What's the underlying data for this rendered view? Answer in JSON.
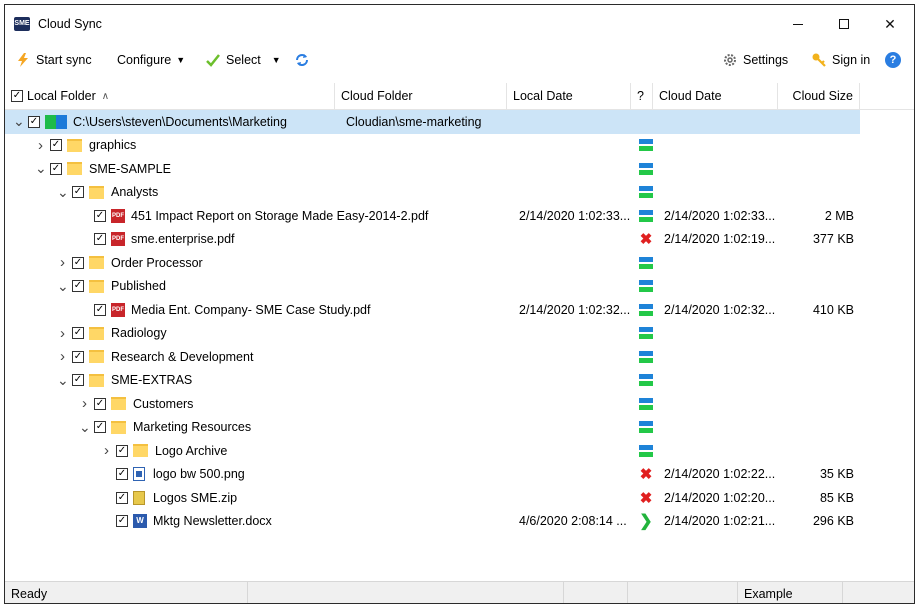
{
  "window": {
    "title": "Cloud Sync",
    "app_icon_text": "SME"
  },
  "toolbar": {
    "start_sync": "Start sync",
    "configure": "Configure",
    "select": "Select",
    "settings": "Settings",
    "sign_in": "Sign in"
  },
  "columns": {
    "local_folder": "Local Folder",
    "cloud_folder": "Cloud Folder",
    "local_date": "Local Date",
    "question": "?",
    "cloud_date": "Cloud Date",
    "cloud_size": "Cloud Size"
  },
  "rows": [
    {
      "name": "C:\\Users\\steven\\Documents\\Marketing",
      "cloud_folder": "Cloudian\\sme-marketing",
      "local_date": "",
      "cloud_date": "",
      "size": "",
      "status": "none",
      "type": "root",
      "expanded": true
    },
    {
      "name": "graphics",
      "cloud_folder": "",
      "local_date": "",
      "cloud_date": "",
      "size": "",
      "status": "synced",
      "type": "folder",
      "expanded": false
    },
    {
      "name": "SME-SAMPLE",
      "cloud_folder": "",
      "local_date": "",
      "cloud_date": "",
      "size": "",
      "status": "synced",
      "type": "folder",
      "expanded": true
    },
    {
      "name": "Analysts",
      "cloud_folder": "",
      "local_date": "",
      "cloud_date": "",
      "size": "",
      "status": "synced",
      "type": "folder",
      "expanded": true
    },
    {
      "name": "451 Impact Report on Storage Made Easy-2014-2.pdf",
      "cloud_folder": "",
      "local_date": "2/14/2020 1:02:33...",
      "cloud_date": "2/14/2020 1:02:33...",
      "size": "2 MB",
      "status": "synced",
      "type": "pdf"
    },
    {
      "name": "sme.enterprise.pdf",
      "cloud_folder": "",
      "local_date": "",
      "cloud_date": "2/14/2020 1:02:19...",
      "size": "377 KB",
      "status": "delete",
      "type": "pdf"
    },
    {
      "name": "Order Processor",
      "cloud_folder": "",
      "local_date": "",
      "cloud_date": "",
      "size": "",
      "status": "synced",
      "type": "folder",
      "expanded": false
    },
    {
      "name": "Published",
      "cloud_folder": "",
      "local_date": "",
      "cloud_date": "",
      "size": "",
      "status": "synced",
      "type": "folder",
      "expanded": true
    },
    {
      "name": "Media Ent. Company- SME Case Study.pdf",
      "cloud_folder": "",
      "local_date": "2/14/2020 1:02:32...",
      "cloud_date": "2/14/2020 1:02:32...",
      "size": "410 KB",
      "status": "synced",
      "type": "pdf"
    },
    {
      "name": "Radiology",
      "cloud_folder": "",
      "local_date": "",
      "cloud_date": "",
      "size": "",
      "status": "synced",
      "type": "folder",
      "expanded": false
    },
    {
      "name": "Research & Development",
      "cloud_folder": "",
      "local_date": "",
      "cloud_date": "",
      "size": "",
      "status": "synced",
      "type": "folder",
      "expanded": false
    },
    {
      "name": "SME-EXTRAS",
      "cloud_folder": "",
      "local_date": "",
      "cloud_date": "",
      "size": "",
      "status": "synced",
      "type": "folder",
      "expanded": true
    },
    {
      "name": "Customers",
      "cloud_folder": "",
      "local_date": "",
      "cloud_date": "",
      "size": "",
      "status": "synced",
      "type": "folder",
      "expanded": false
    },
    {
      "name": "Marketing Resources",
      "cloud_folder": "",
      "local_date": "",
      "cloud_date": "",
      "size": "",
      "status": "synced",
      "type": "folder",
      "expanded": true
    },
    {
      "name": "Logo Archive",
      "cloud_folder": "",
      "local_date": "",
      "cloud_date": "",
      "size": "",
      "status": "synced",
      "type": "folder",
      "expanded": false
    },
    {
      "name": "logo bw 500.png",
      "cloud_folder": "",
      "local_date": "",
      "cloud_date": "2/14/2020 1:02:22...",
      "size": "35 KB",
      "status": "delete",
      "type": "png"
    },
    {
      "name": "Logos SME.zip",
      "cloud_folder": "",
      "local_date": "",
      "cloud_date": "2/14/2020 1:02:20...",
      "size": "85 KB",
      "status": "delete",
      "type": "zip"
    },
    {
      "name": "Mktg Newsletter.docx",
      "cloud_folder": "",
      "local_date": "4/6/2020 2:08:14 ...",
      "cloud_date": "2/14/2020 1:02:21...",
      "size": "296 KB",
      "status": "upload",
      "type": "docx"
    }
  ],
  "statusbar": {
    "left": "Ready",
    "right": "Example"
  },
  "colors": {
    "selection": "#cce4f7",
    "folder": "#ffd766",
    "synced_blue": "#1e83d8",
    "synced_green": "#23c848",
    "delete_red": "#e02020",
    "upload_green": "#22b33c"
  }
}
